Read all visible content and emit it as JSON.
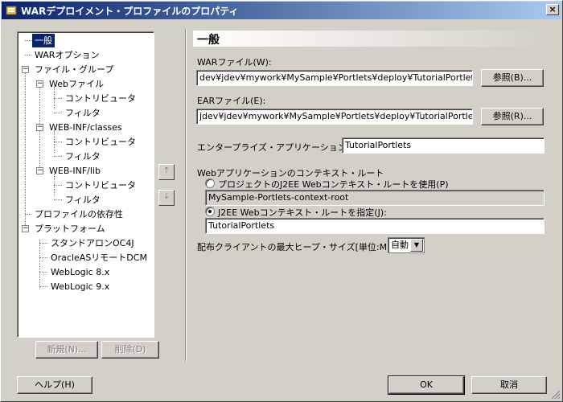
{
  "window": {
    "title": "WARデプロイメント・プロファイルのプロパティ",
    "close_glyph": "×"
  },
  "tree": {
    "nodes": [
      {
        "label": "一般",
        "selected": true
      },
      {
        "label": "WARオプション"
      },
      {
        "label": "ファイル・グループ",
        "expander": "−"
      },
      {
        "label": "Webファイル",
        "expander": "−"
      },
      {
        "label": "コントリビュータ"
      },
      {
        "label": "フィルタ"
      },
      {
        "label": "WEB-INF/classes",
        "expander": "−"
      },
      {
        "label": "コントリビュータ"
      },
      {
        "label": "フィルタ"
      },
      {
        "label": "WEB-INF/lib",
        "expander": "−"
      },
      {
        "label": "コントリビュータ"
      },
      {
        "label": "フィルタ"
      },
      {
        "label": "プロファイルの依存性"
      },
      {
        "label": "プラットフォーム",
        "expander": "−"
      },
      {
        "label": "スタンドアロンOC4J"
      },
      {
        "label": "OracleASリモートDCM"
      },
      {
        "label": "WebLogic 8.x"
      },
      {
        "label": "WebLogic 9.x"
      }
    ],
    "new_button": "新規(N)...",
    "delete_button": "削除(D)"
  },
  "order_buttons": {
    "up_glyph": "⇡",
    "down_glyph": "⇣"
  },
  "general": {
    "heading": "一般",
    "war_label": "WARファイル(W):",
    "war_value": "dev¥jdev¥mywork¥MySample¥Portlets¥deploy¥TutorialPortlets.war",
    "war_browse": "参照(B)...",
    "ear_label": "EARファイル(E):",
    "ear_value": "jdev¥jdev¥mywork¥MySample¥Portlets¥deploy¥TutorialPortlets.ear",
    "ear_browse": "参照(R)...",
    "app_name_label": "エンタープライズ・アプリケーション名(A):",
    "app_name_value": "TutorialPortlets",
    "context_root_label": "Webアプリケーションのコンテキスト・ルート",
    "radio_project_label": "プロジェクトのJ2EE Webコンテキスト・ルートを使用(P)",
    "project_root_value": "MySample-Portlets-context-root",
    "radio_specify_label": "J2EE Webコンテキスト・ルートを指定(J):",
    "specify_root_value": "TutorialPortlets",
    "heap_label": "配布クライアントの最大ヒープ・サイズ[単位:MB](X):",
    "heap_value": "自動",
    "heap_arrow": "▼"
  },
  "footer": {
    "help": "ヘルプ(H)",
    "ok": "OK",
    "cancel": "取消"
  }
}
